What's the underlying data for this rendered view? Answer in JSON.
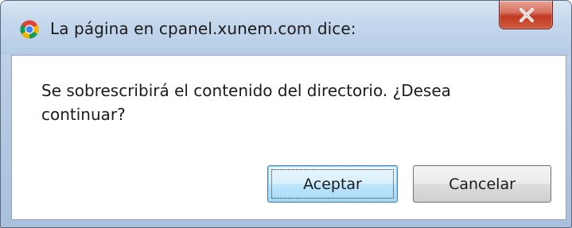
{
  "dialog": {
    "title": "La página en cpanel.xunem.com dice:",
    "message": "Se sobrescribirá el contenido del directorio. ¿Desea continuar?",
    "buttons": {
      "accept_label": "Aceptar",
      "cancel_label": "Cancelar"
    },
    "title_icon": "chrome-logo-icon",
    "close_icon": "close-icon"
  },
  "colors": {
    "titlebar": "#c3d6ec",
    "close_button": "#c13a22",
    "accept_focus": "#3c7fb1"
  }
}
